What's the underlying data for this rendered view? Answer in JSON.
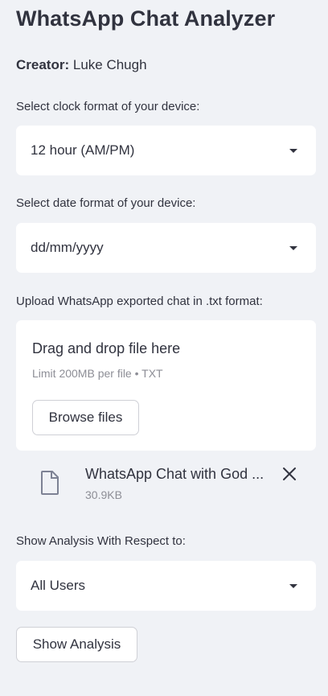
{
  "app": {
    "title": "WhatsApp Chat Analyzer"
  },
  "creator": {
    "label": "Creator:",
    "name": "Luke Chugh"
  },
  "clock_format": {
    "label": "Select clock format of your device:",
    "selected": "12 hour (AM/PM)"
  },
  "date_format": {
    "label": "Select date format of your device:",
    "selected": "dd/mm/yyyy"
  },
  "upload": {
    "label": "Upload WhatsApp exported chat in .txt format:",
    "drop_title": "Drag and drop file here",
    "drop_limit": "Limit 200MB per file • TXT",
    "browse_label": "Browse files",
    "file": {
      "name": "WhatsApp Chat with God ...",
      "size": "30.9KB"
    }
  },
  "analysis": {
    "label": "Show Analysis With Respect to:",
    "selected": "All Users",
    "button_label": "Show Analysis"
  },
  "icons": {
    "dropdown": "chevron-down-icon",
    "file": "file-icon",
    "remove": "close-icon"
  }
}
